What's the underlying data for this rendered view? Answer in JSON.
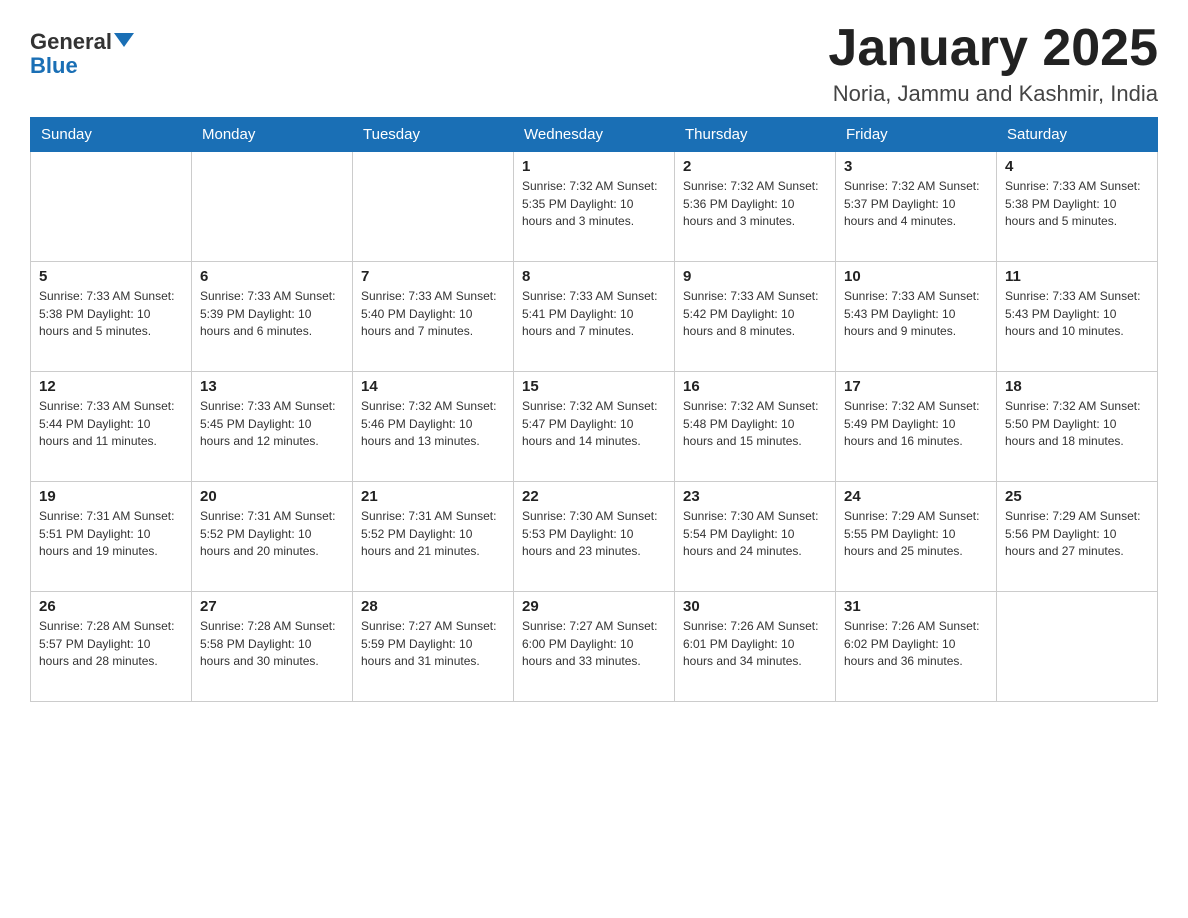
{
  "header": {
    "logo_general": "General",
    "logo_blue": "Blue",
    "month_title": "January 2025",
    "location": "Noria, Jammu and Kashmir, India"
  },
  "days_of_week": [
    "Sunday",
    "Monday",
    "Tuesday",
    "Wednesday",
    "Thursday",
    "Friday",
    "Saturday"
  ],
  "weeks": [
    [
      {
        "day": "",
        "info": ""
      },
      {
        "day": "",
        "info": ""
      },
      {
        "day": "",
        "info": ""
      },
      {
        "day": "1",
        "info": "Sunrise: 7:32 AM\nSunset: 5:35 PM\nDaylight: 10 hours and 3 minutes."
      },
      {
        "day": "2",
        "info": "Sunrise: 7:32 AM\nSunset: 5:36 PM\nDaylight: 10 hours and 3 minutes."
      },
      {
        "day": "3",
        "info": "Sunrise: 7:32 AM\nSunset: 5:37 PM\nDaylight: 10 hours and 4 minutes."
      },
      {
        "day": "4",
        "info": "Sunrise: 7:33 AM\nSunset: 5:38 PM\nDaylight: 10 hours and 5 minutes."
      }
    ],
    [
      {
        "day": "5",
        "info": "Sunrise: 7:33 AM\nSunset: 5:38 PM\nDaylight: 10 hours and 5 minutes."
      },
      {
        "day": "6",
        "info": "Sunrise: 7:33 AM\nSunset: 5:39 PM\nDaylight: 10 hours and 6 minutes."
      },
      {
        "day": "7",
        "info": "Sunrise: 7:33 AM\nSunset: 5:40 PM\nDaylight: 10 hours and 7 minutes."
      },
      {
        "day": "8",
        "info": "Sunrise: 7:33 AM\nSunset: 5:41 PM\nDaylight: 10 hours and 7 minutes."
      },
      {
        "day": "9",
        "info": "Sunrise: 7:33 AM\nSunset: 5:42 PM\nDaylight: 10 hours and 8 minutes."
      },
      {
        "day": "10",
        "info": "Sunrise: 7:33 AM\nSunset: 5:43 PM\nDaylight: 10 hours and 9 minutes."
      },
      {
        "day": "11",
        "info": "Sunrise: 7:33 AM\nSunset: 5:43 PM\nDaylight: 10 hours and 10 minutes."
      }
    ],
    [
      {
        "day": "12",
        "info": "Sunrise: 7:33 AM\nSunset: 5:44 PM\nDaylight: 10 hours and 11 minutes."
      },
      {
        "day": "13",
        "info": "Sunrise: 7:33 AM\nSunset: 5:45 PM\nDaylight: 10 hours and 12 minutes."
      },
      {
        "day": "14",
        "info": "Sunrise: 7:32 AM\nSunset: 5:46 PM\nDaylight: 10 hours and 13 minutes."
      },
      {
        "day": "15",
        "info": "Sunrise: 7:32 AM\nSunset: 5:47 PM\nDaylight: 10 hours and 14 minutes."
      },
      {
        "day": "16",
        "info": "Sunrise: 7:32 AM\nSunset: 5:48 PM\nDaylight: 10 hours and 15 minutes."
      },
      {
        "day": "17",
        "info": "Sunrise: 7:32 AM\nSunset: 5:49 PM\nDaylight: 10 hours and 16 minutes."
      },
      {
        "day": "18",
        "info": "Sunrise: 7:32 AM\nSunset: 5:50 PM\nDaylight: 10 hours and 18 minutes."
      }
    ],
    [
      {
        "day": "19",
        "info": "Sunrise: 7:31 AM\nSunset: 5:51 PM\nDaylight: 10 hours and 19 minutes."
      },
      {
        "day": "20",
        "info": "Sunrise: 7:31 AM\nSunset: 5:52 PM\nDaylight: 10 hours and 20 minutes."
      },
      {
        "day": "21",
        "info": "Sunrise: 7:31 AM\nSunset: 5:52 PM\nDaylight: 10 hours and 21 minutes."
      },
      {
        "day": "22",
        "info": "Sunrise: 7:30 AM\nSunset: 5:53 PM\nDaylight: 10 hours and 23 minutes."
      },
      {
        "day": "23",
        "info": "Sunrise: 7:30 AM\nSunset: 5:54 PM\nDaylight: 10 hours and 24 minutes."
      },
      {
        "day": "24",
        "info": "Sunrise: 7:29 AM\nSunset: 5:55 PM\nDaylight: 10 hours and 25 minutes."
      },
      {
        "day": "25",
        "info": "Sunrise: 7:29 AM\nSunset: 5:56 PM\nDaylight: 10 hours and 27 minutes."
      }
    ],
    [
      {
        "day": "26",
        "info": "Sunrise: 7:28 AM\nSunset: 5:57 PM\nDaylight: 10 hours and 28 minutes."
      },
      {
        "day": "27",
        "info": "Sunrise: 7:28 AM\nSunset: 5:58 PM\nDaylight: 10 hours and 30 minutes."
      },
      {
        "day": "28",
        "info": "Sunrise: 7:27 AM\nSunset: 5:59 PM\nDaylight: 10 hours and 31 minutes."
      },
      {
        "day": "29",
        "info": "Sunrise: 7:27 AM\nSunset: 6:00 PM\nDaylight: 10 hours and 33 minutes."
      },
      {
        "day": "30",
        "info": "Sunrise: 7:26 AM\nSunset: 6:01 PM\nDaylight: 10 hours and 34 minutes."
      },
      {
        "day": "31",
        "info": "Sunrise: 7:26 AM\nSunset: 6:02 PM\nDaylight: 10 hours and 36 minutes."
      },
      {
        "day": "",
        "info": ""
      }
    ]
  ]
}
